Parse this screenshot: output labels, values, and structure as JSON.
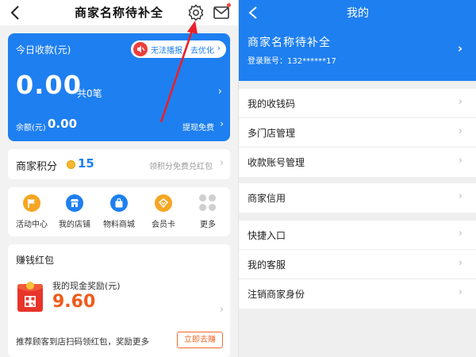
{
  "left": {
    "header": {
      "title": "商家名称待补全"
    },
    "today": {
      "label": "今日收款(元)",
      "alert": "无法播报，去优化",
      "amount": "0.00",
      "count": "共0笔",
      "balance_label": "余额(元)",
      "balance": "0.00",
      "withdraw": "提现免费"
    },
    "points": {
      "label": "商家积分",
      "value": "15",
      "link": "领积分免费兑红包"
    },
    "shortcuts": [
      {
        "label": "活动中心",
        "icon": "flag-icon",
        "color": "#f5a623"
      },
      {
        "label": "我的店铺",
        "icon": "store-icon",
        "color": "#1e7ff0"
      },
      {
        "label": "物料商城",
        "icon": "shop-bag-icon",
        "color": "#1e7ff0"
      },
      {
        "label": "会员卡",
        "icon": "member-card-icon",
        "color": "#f5a623"
      },
      {
        "label": "更多",
        "icon": "more-grid-icon",
        "color": "#cfcfcf"
      }
    ],
    "redpacket": {
      "title": "赚钱红包",
      "subtitle": "我的现金奖励(元)",
      "amount": "9.60",
      "description": "推荐顾客到店扫码领红包，奖励更多",
      "button": "立即去赚"
    }
  },
  "right": {
    "header": {
      "title": "我的"
    },
    "profile": {
      "name": "商家名称待补全",
      "account": "登录账号：132******17"
    },
    "groups": [
      [
        "我的收钱码",
        "多门店管理",
        "收款账号管理"
      ],
      [
        "商家信用"
      ],
      [
        "快捷入口",
        "我的客服",
        "注销商家身份"
      ]
    ]
  },
  "colors": {
    "brand_blue": "#1e7ff0",
    "annotation_red": "#e8202a",
    "reward_orange": "#f05a1a"
  }
}
